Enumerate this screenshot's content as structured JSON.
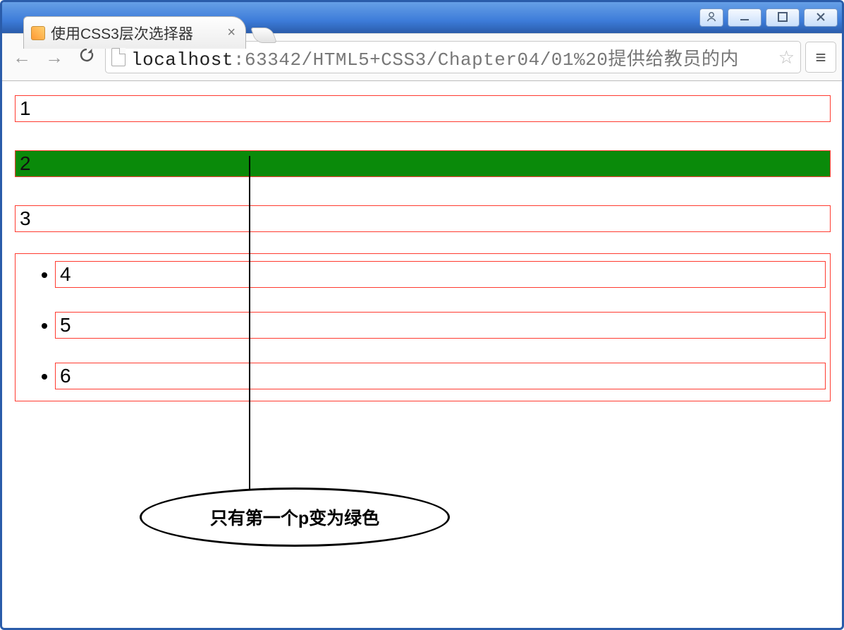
{
  "window": {
    "title": "使用CSS3层次选择器"
  },
  "tab": {
    "title": "使用CSS3层次选择器"
  },
  "navigation": {
    "url_host": "localhost",
    "url_path": ":63342/HTML5+CSS3/Chapter04/01%20提供给教员的内"
  },
  "content": {
    "items": [
      "1",
      "2",
      "3"
    ],
    "list_items": [
      "4",
      "5",
      "6"
    ],
    "highlight_index": 1
  },
  "annotation": {
    "text": "只有第一个p变为绿色"
  },
  "colors": {
    "border": "#ff3b30",
    "highlight_bg": "#0a8a0a"
  }
}
